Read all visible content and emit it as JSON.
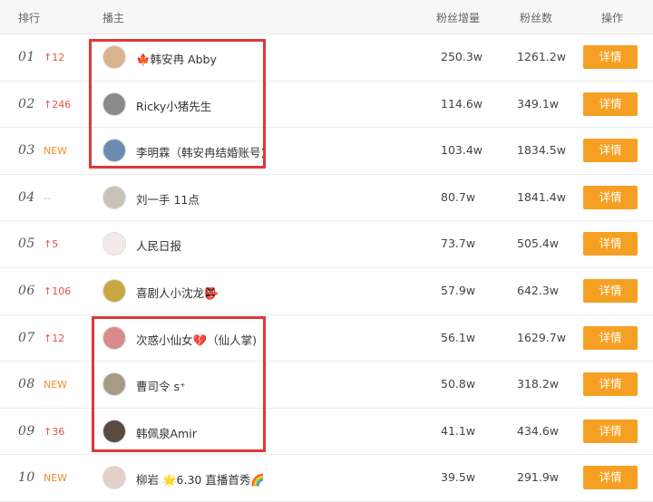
{
  "header": {
    "rank": "排行",
    "anchor": "播主",
    "fans_gain": "粉丝增量",
    "fans": "粉丝数",
    "action": "操作"
  },
  "rows": [
    {
      "rank": "01",
      "trend": "↑12",
      "trend_type": "up",
      "name": "🍁韩安冉 Abby",
      "gain": "250.3w",
      "fans": "1261.2w",
      "button": "详情",
      "avatar_color": "#d9b38c"
    },
    {
      "rank": "02",
      "trend": "↑246",
      "trend_type": "up",
      "name": "Ricky小猪先生",
      "gain": "114.6w",
      "fans": "349.1w",
      "button": "详情",
      "avatar_color": "#8a8a8a"
    },
    {
      "rank": "03",
      "trend": "NEW",
      "trend_type": "new",
      "name": "李明霖（韩安冉结婚账号)",
      "gain": "103.4w",
      "fans": "1834.5w",
      "button": "详情",
      "avatar_color": "#6b8bb0"
    },
    {
      "rank": "04",
      "trend": "--",
      "trend_type": "flat",
      "name": "刘一手 11点",
      "gain": "80.7w",
      "fans": "1841.4w",
      "button": "详情",
      "avatar_color": "#c9c2b6"
    },
    {
      "rank": "05",
      "trend": "↑5",
      "trend_type": "up",
      "name": "人民日报",
      "gain": "73.7w",
      "fans": "505.4w",
      "button": "详情",
      "avatar_color": "#f4e9e9"
    },
    {
      "rank": "06",
      "trend": "↑106",
      "trend_type": "up",
      "name": "喜剧人小沈龙👺",
      "gain": "57.9w",
      "fans": "642.3w",
      "button": "详情",
      "avatar_color": "#c8a640"
    },
    {
      "rank": "07",
      "trend": "↑12",
      "trend_type": "up",
      "name": "次惑小仙女💔（仙人掌)",
      "gain": "56.1w",
      "fans": "1629.7w",
      "button": "详情",
      "avatar_color": "#d98a8a"
    },
    {
      "rank": "08",
      "trend": "NEW",
      "trend_type": "new",
      "name": "曹司令 s⁺",
      "gain": "50.8w",
      "fans": "318.2w",
      "button": "详情",
      "avatar_color": "#a79a86"
    },
    {
      "rank": "09",
      "trend": "↑36",
      "trend_type": "up",
      "name": "韩佩泉Amir",
      "gain": "41.1w",
      "fans": "434.6w",
      "button": "详情",
      "avatar_color": "#5a4a40"
    },
    {
      "rank": "10",
      "trend": "NEW",
      "trend_type": "new",
      "name": "柳岩 🌟6.30 直播首秀🌈",
      "gain": "39.5w",
      "fans": "291.9w",
      "button": "详情",
      "avatar_color": "#e5cfc8"
    }
  ],
  "colors": {
    "accent_button": "#f5a023",
    "trend_up": "#e2514e",
    "trend_new": "#f08c2e",
    "highlight_box": "#e0373a"
  }
}
